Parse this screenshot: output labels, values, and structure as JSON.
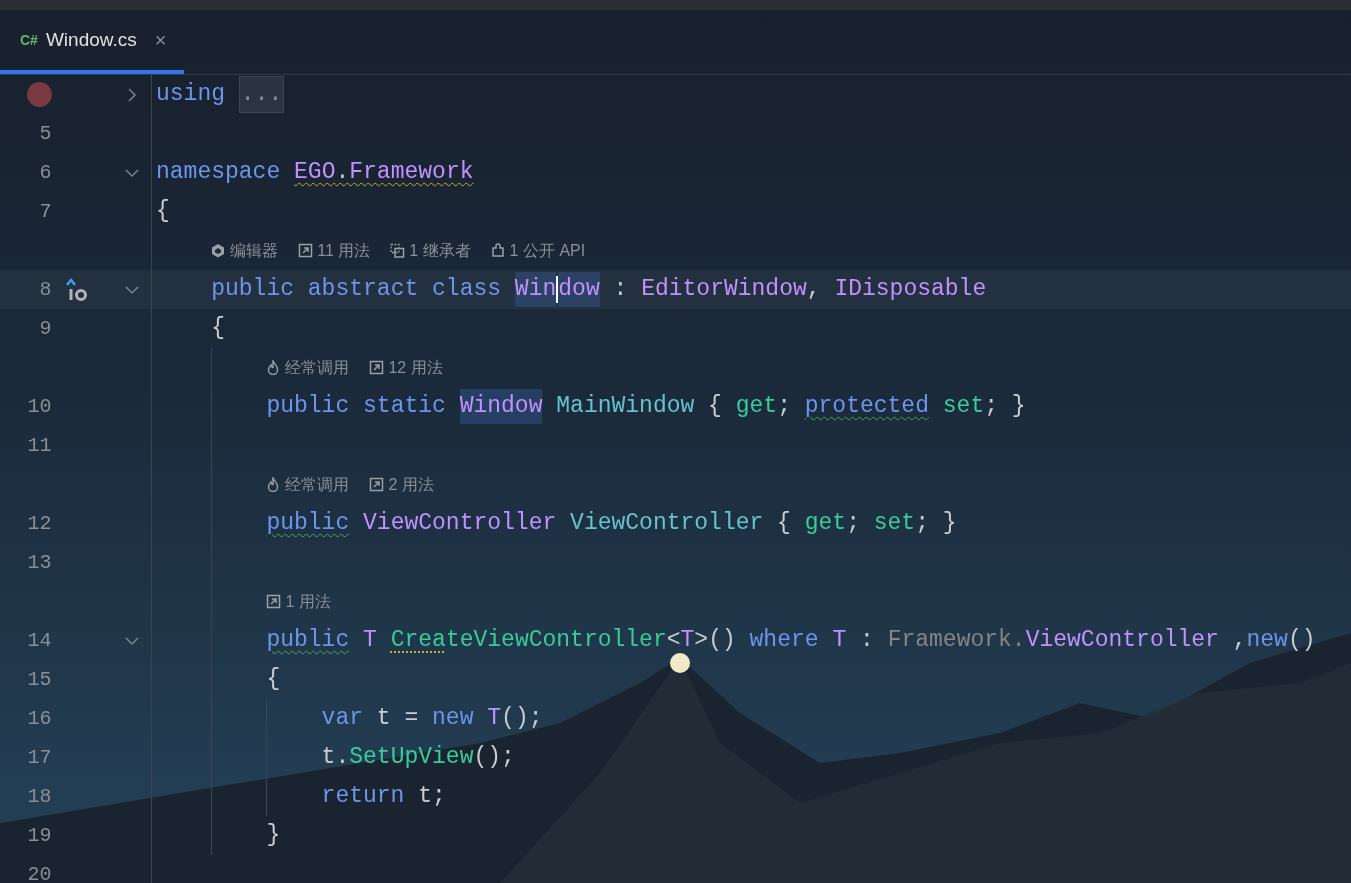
{
  "tabs": [
    {
      "badge": "C#",
      "title": "Window.cs",
      "close": "×",
      "selected": true
    }
  ],
  "editor": {
    "rows": [
      {
        "kind": "code",
        "breakpoint": true,
        "expanded": false,
        "tokens": [
          {
            "t": "using ",
            "kind": "kw"
          },
          {
            "t": "...",
            "kind": "folded"
          }
        ]
      },
      {
        "kind": "code",
        "number": "5",
        "tokens": []
      },
      {
        "kind": "code",
        "number": "6",
        "expanded": true,
        "tokens": [
          {
            "t": "namespace ",
            "kind": "kw"
          },
          {
            "t": "EGO",
            "kind": "ns",
            "warning": true
          },
          {
            "t": ".",
            "kind": "plain",
            "warning": true
          },
          {
            "t": "Framework",
            "kind": "ns",
            "warning": true
          }
        ]
      },
      {
        "kind": "code",
        "number": "7",
        "tokens": [
          {
            "t": "{",
            "kind": "plain"
          }
        ]
      },
      {
        "kind": "hint",
        "items": [
          {
            "kind": "unity",
            "text": "编辑器"
          },
          {
            "kind": "usages",
            "text": "11 用法"
          },
          {
            "kind": "inheritors",
            "text": "1 继承者"
          },
          {
            "kind": "api",
            "text": "1 公开 API"
          }
        ]
      },
      {
        "kind": "code",
        "number": "8",
        "current": true,
        "implemented": true,
        "expanded": true,
        "tokens": [
          {
            "t": "    public abstract class ",
            "kind": "kw"
          },
          {
            "t": "Win",
            "kind": "type",
            "highlight": true,
            "caret": true
          },
          {
            "t": "dow",
            "kind": "type",
            "highlight": true
          },
          {
            "t": " : ",
            "kind": "plain"
          },
          {
            "t": "EditorWindow",
            "kind": "type"
          },
          {
            "t": ", ",
            "kind": "plain"
          },
          {
            "t": "IDisposable",
            "kind": "type"
          }
        ]
      },
      {
        "kind": "code",
        "number": "9",
        "tokens": [
          {
            "t": "    {",
            "kind": "plain"
          }
        ]
      },
      {
        "kind": "hint",
        "items": [
          {
            "kind": "hot",
            "text": "经常调用"
          },
          {
            "kind": "usages",
            "text": "12 用法"
          }
        ]
      },
      {
        "kind": "code",
        "number": "10",
        "tokens": [
          {
            "t": "        public static ",
            "kind": "kw"
          },
          {
            "t": "Window",
            "kind": "type",
            "highlight": true
          },
          {
            "t": " MainWindow",
            "kind": "prop"
          },
          {
            "t": " { ",
            "kind": "plain"
          },
          {
            "t": "get",
            "kind": "method"
          },
          {
            "t": "; ",
            "kind": "plain"
          },
          {
            "t": "protected",
            "kind": "kw",
            "suggestion": true
          },
          {
            "t": " set",
            "kind": "method"
          },
          {
            "t": "; }",
            "kind": "plain"
          }
        ]
      },
      {
        "kind": "code",
        "number": "11",
        "tokens": []
      },
      {
        "kind": "hint",
        "items": [
          {
            "kind": "hot",
            "text": "经常调用"
          },
          {
            "kind": "usages",
            "text": "2 用法"
          }
        ]
      },
      {
        "kind": "code",
        "number": "12",
        "tokens": [
          {
            "t": "        public",
            "kind": "kw",
            "suggestion": true
          },
          {
            "t": " ViewController ",
            "kind": "type"
          },
          {
            "t": "ViewController",
            "kind": "prop"
          },
          {
            "t": " { ",
            "kind": "plain"
          },
          {
            "t": "get",
            "kind": "method"
          },
          {
            "t": "; ",
            "kind": "plain"
          },
          {
            "t": "set",
            "kind": "method"
          },
          {
            "t": "; }",
            "kind": "plain"
          }
        ]
      },
      {
        "kind": "code",
        "number": "13",
        "tokens": []
      },
      {
        "kind": "hint",
        "items": [
          {
            "kind": "usages",
            "text": "1 用法"
          }
        ]
      },
      {
        "kind": "code",
        "number": "14",
        "expanded": true,
        "tokens": [
          {
            "t": "        public",
            "kind": "kw",
            "suggestion": true
          },
          {
            "t": " T ",
            "kind": "type"
          },
          {
            "t": "Crea",
            "kind": "method",
            "dotted": true
          },
          {
            "t": "teViewController",
            "kind": "method"
          },
          {
            "t": "<",
            "kind": "plain"
          },
          {
            "t": "T",
            "kind": "type"
          },
          {
            "t": ">() ",
            "kind": "plain"
          },
          {
            "t": "where ",
            "kind": "kw"
          },
          {
            "t": "T",
            "kind": "type"
          },
          {
            "t": " : ",
            "kind": "plain"
          },
          {
            "t": "Framework.",
            "kind": "dim"
          },
          {
            "t": "ViewController",
            "kind": "type"
          },
          {
            "t": " ,",
            "kind": "plain"
          },
          {
            "t": "new",
            "kind": "kw"
          },
          {
            "t": "()",
            "kind": "plain"
          }
        ]
      },
      {
        "kind": "code",
        "number": "15",
        "tokens": [
          {
            "t": "        {",
            "kind": "plain"
          }
        ]
      },
      {
        "kind": "code",
        "number": "16",
        "tokens": [
          {
            "t": "            var",
            "kind": "kw"
          },
          {
            "t": " t = ",
            "kind": "plain"
          },
          {
            "t": "new ",
            "kind": "kw"
          },
          {
            "t": "T",
            "kind": "type"
          },
          {
            "t": "();",
            "kind": "plain"
          }
        ]
      },
      {
        "kind": "code",
        "number": "17",
        "tokens": [
          {
            "t": "            t.",
            "kind": "plain"
          },
          {
            "t": "SetUpView",
            "kind": "method"
          },
          {
            "t": "();",
            "kind": "plain"
          }
        ]
      },
      {
        "kind": "code",
        "number": "18",
        "tokens": [
          {
            "t": "            return",
            "kind": "kw"
          },
          {
            "t": " t;",
            "kind": "plain"
          }
        ]
      },
      {
        "kind": "code",
        "number": "19",
        "tokens": [
          {
            "t": "        }",
            "kind": "plain"
          }
        ]
      },
      {
        "kind": "code",
        "number": "20",
        "tokens": []
      }
    ]
  }
}
